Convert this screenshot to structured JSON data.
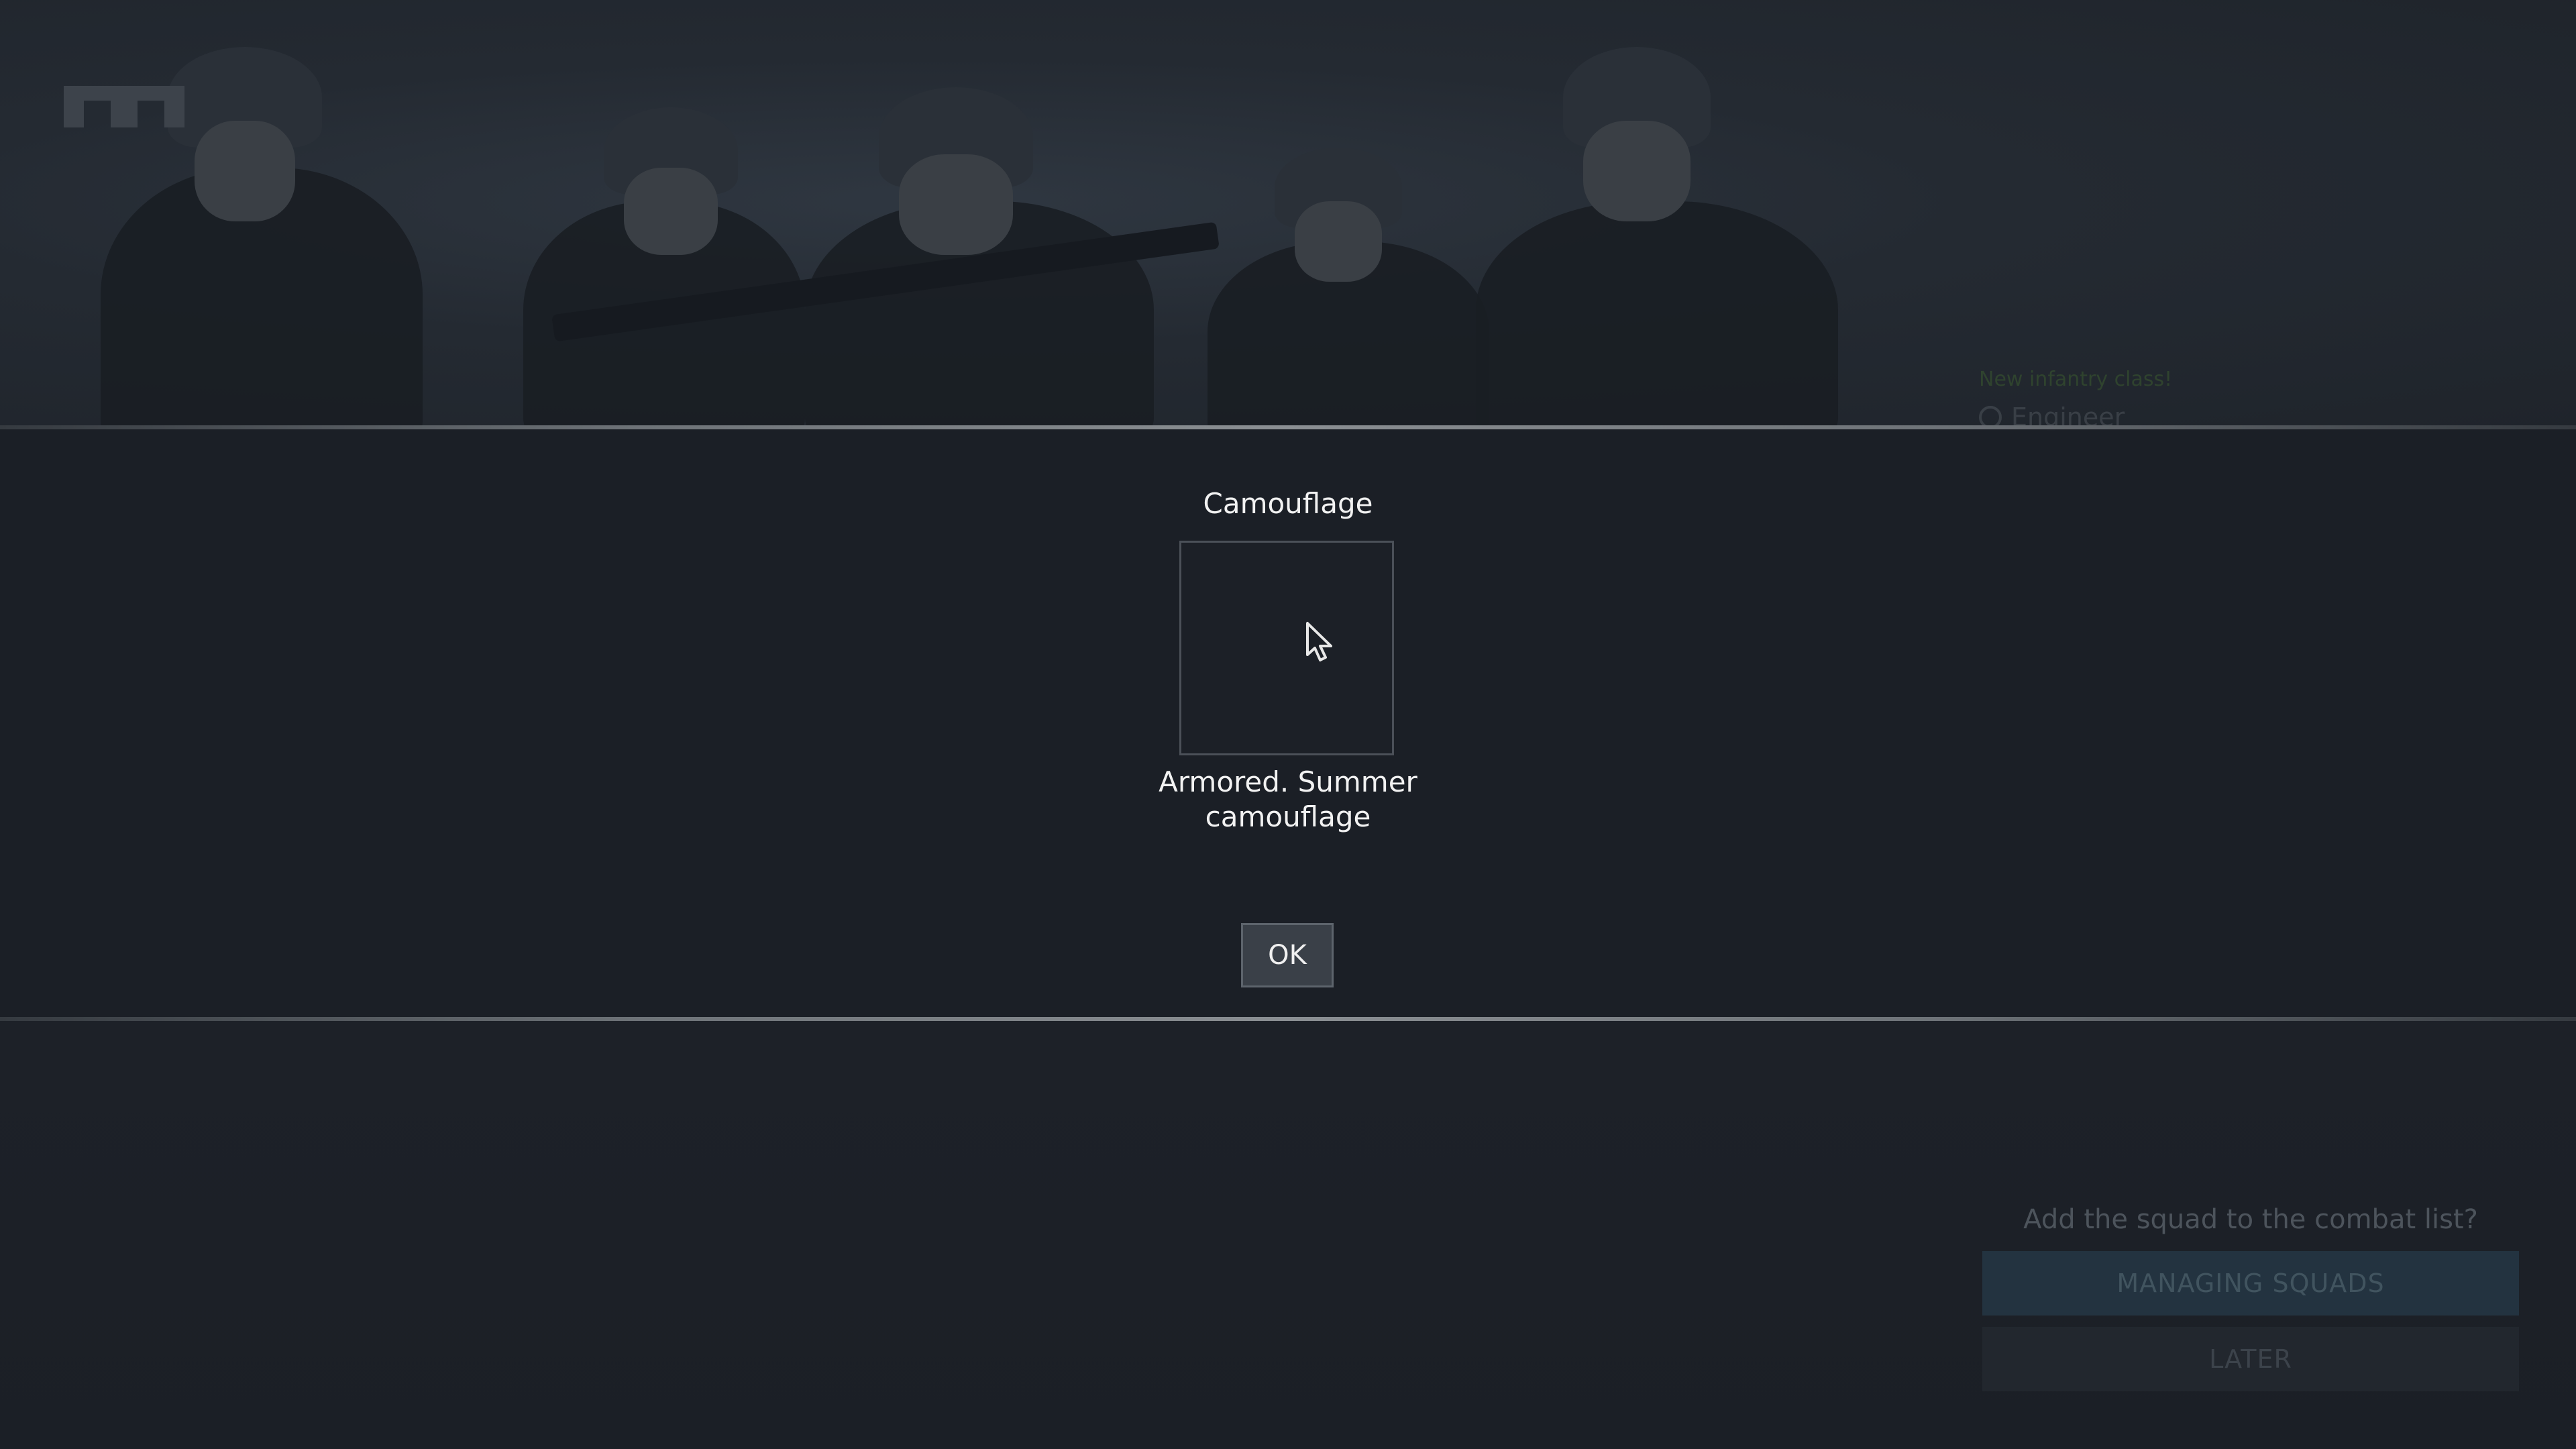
{
  "background": {
    "side_notice": {
      "label": "New infantry class!",
      "class_name": "Engineer"
    },
    "squad_prompt": {
      "question": "Add the squad to the combat list?",
      "primary_button": "MANAGING SQUADS",
      "secondary_button": "LATER"
    }
  },
  "modal": {
    "title": "Camouflage",
    "item_name_line1": "Armored. Summer",
    "item_name_line2": "camouflage",
    "ok_label": "OK"
  },
  "icons": {
    "logo": "game-logo-icon",
    "cursor": "mouse-cursor-icon"
  },
  "colors": {
    "background": "#1e2229",
    "band": "#1b1f26",
    "text": "#f2f2f2",
    "button_bg": "#3a4048",
    "side_notice_green": "#3b5a2f"
  }
}
